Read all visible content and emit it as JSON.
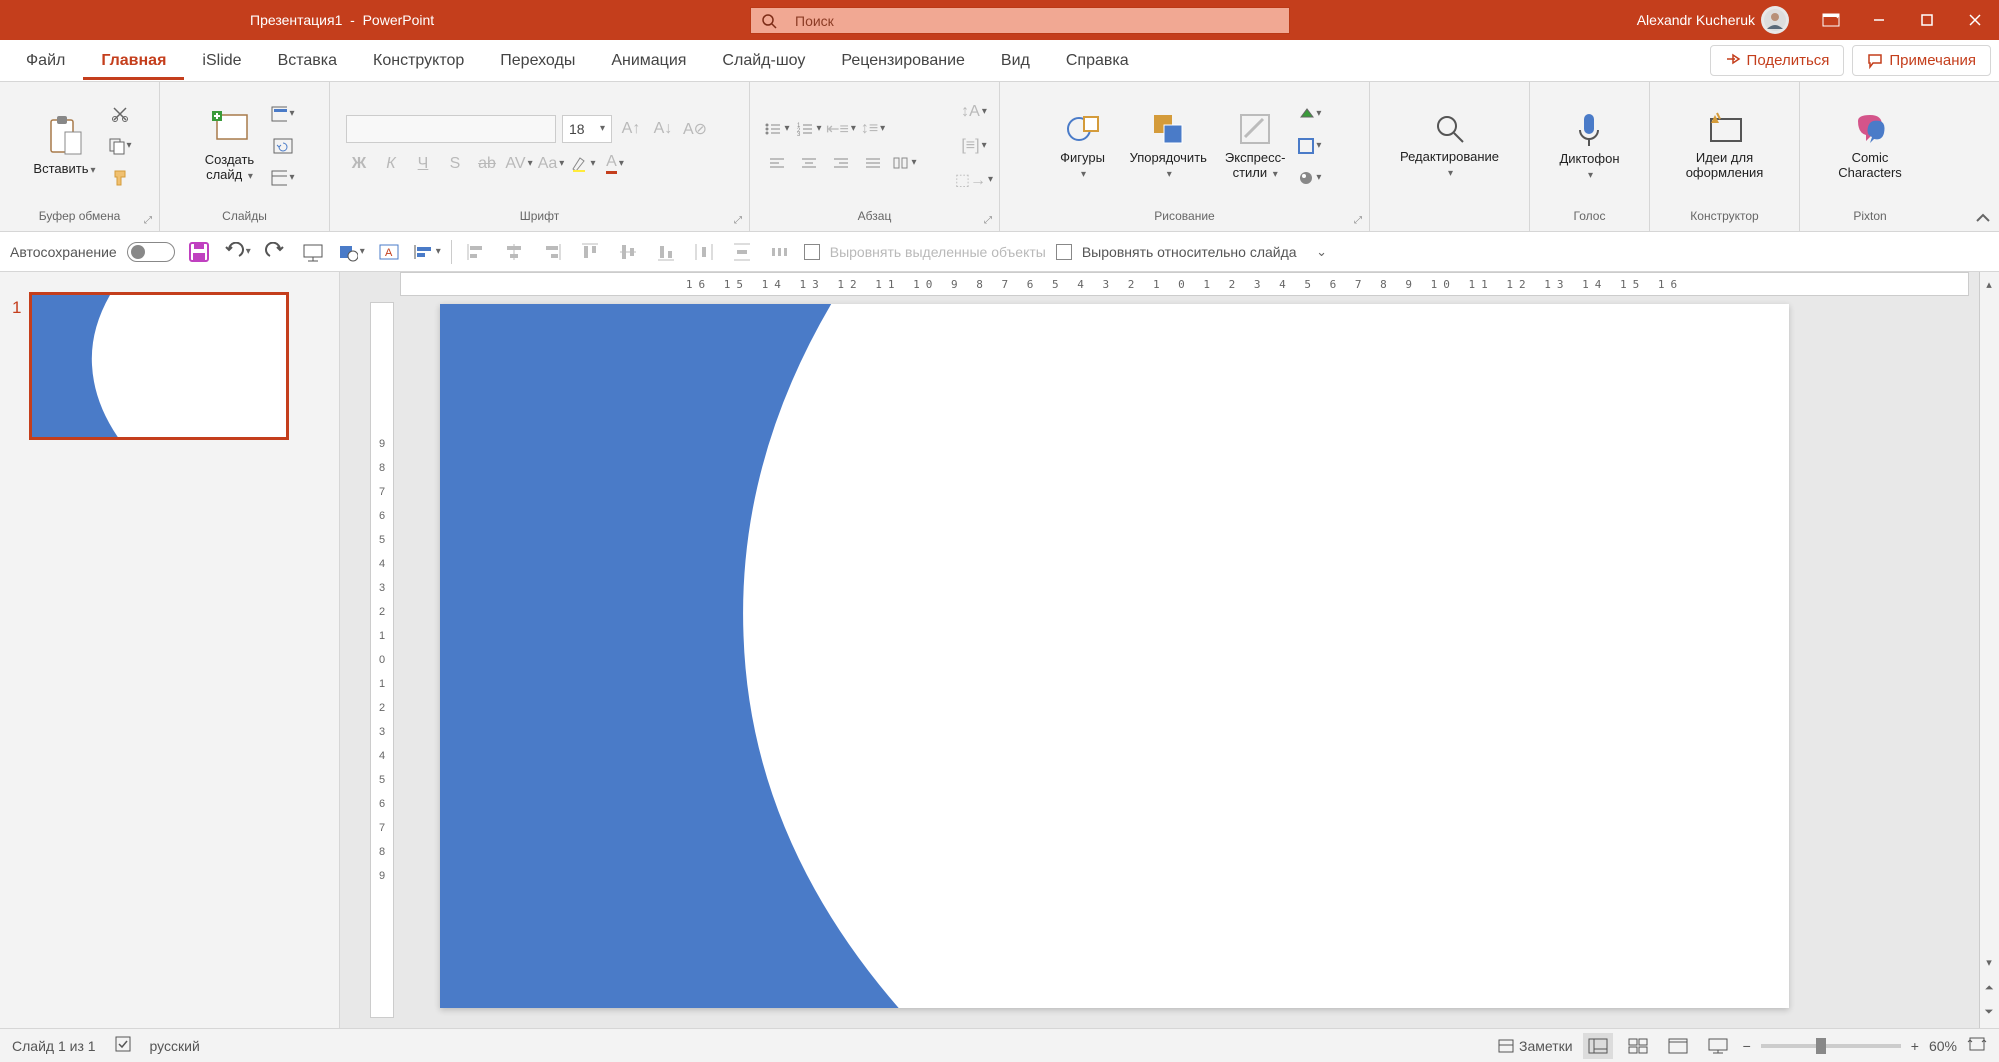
{
  "title": {
    "doc": "Презентация1",
    "app": "PowerPoint"
  },
  "search_placeholder": "Поиск",
  "user": "Alexandr Kucheruk",
  "tabs": {
    "file": "Файл",
    "home": "Главная",
    "islide": "iSlide",
    "insert": "Вставка",
    "designer": "Конструктор",
    "transitions": "Переходы",
    "animation": "Анимация",
    "slideshow": "Слайд-шоу",
    "review": "Рецензирование",
    "view": "Вид",
    "help": "Справка"
  },
  "share": "Поделиться",
  "comments": "Примечания",
  "groups": {
    "clipboard": {
      "label": "Буфер обмена",
      "paste": "Вставить"
    },
    "slides": {
      "label": "Слайды",
      "new": "Создать\nслайд"
    },
    "font": {
      "label": "Шрифт",
      "size": "18"
    },
    "paragraph": {
      "label": "Абзац"
    },
    "drawing": {
      "label": "Рисование",
      "shapes": "Фигуры",
      "arrange": "Упорядочить",
      "styles": "Экспресс-\nстили"
    },
    "editing": {
      "label": "",
      "edit": "Редактирование"
    },
    "voice": {
      "label": "Голос",
      "dictate": "Диктофон"
    },
    "designer_g": {
      "label": "Конструктор",
      "ideas": "Идеи для\nоформления"
    },
    "pixton": {
      "label": "Pixton",
      "comic": "Comic\nCharacters"
    }
  },
  "qat": {
    "autosave": "Автосохранение",
    "align_selected": "Выровнять выделенные объекты",
    "align_slide": "Выровнять относительно слайда"
  },
  "thumb": {
    "num": "1"
  },
  "status": {
    "slide_of": "Слайд 1 из 1",
    "language": "русский",
    "notes": "Заметки",
    "zoom": "60%"
  },
  "ruler_h": "16 15 14 13 12 11 10  9  8  7  6  5  4  3  2  1  0  1  2  3  4  5  6  7  8  9 10 11 12 13 14 15 16",
  "ruler_v": [
    "9",
    "8",
    "7",
    "6",
    "5",
    "4",
    "3",
    "2",
    "1",
    "0",
    "1",
    "2",
    "3",
    "4",
    "5",
    "6",
    "7",
    "8",
    "9"
  ]
}
